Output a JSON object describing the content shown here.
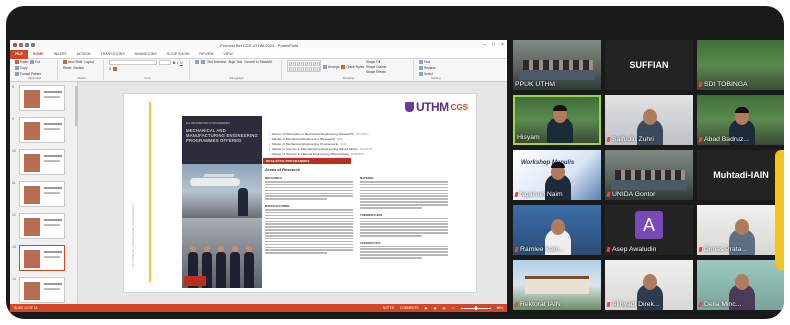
{
  "ppt": {
    "window_title": "Promosi Bei CGS UTHM 2021 - PowerPoint",
    "tabs": [
      "FILE",
      "HOME",
      "INSERT",
      "DESIGN",
      "TRANSITIONS",
      "ANIMATIONS",
      "SLIDE SHOW",
      "REVIEW",
      "VIEW"
    ],
    "ribbon": {
      "clipboard": {
        "items": [
          "Cut",
          "Copy",
          "Format Painter"
        ],
        "label": "Clipboard",
        "paste": "Paste"
      },
      "slides": {
        "items": [
          "Layout",
          "Reset",
          "Section"
        ],
        "label": "Slides",
        "new": "New Slide"
      },
      "font": {
        "label": "Font"
      },
      "paragraph": {
        "label": "Paragraph",
        "items": [
          "Text Direction",
          "Align Text",
          "Convert to SmartArt"
        ]
      },
      "drawing": {
        "label": "Drawing",
        "items": [
          "Shape Fill",
          "Shape Outline",
          "Shape Effects"
        ],
        "arrange": "Arrange",
        "quick": "Quick Styles"
      },
      "editing": {
        "label": "Editing",
        "items": [
          "Find",
          "Replace",
          "Select"
        ]
      }
    },
    "thumbnails": [
      "8",
      "9",
      "10",
      "11",
      "12",
      "13",
      "14"
    ],
    "selected_thumb": "13",
    "slide": {
      "logo_text": "UTHM",
      "logo_suffix": "CGS",
      "side_text": "MECHANICAL ENGINEERING PROGRAMMES",
      "brochure_small": "ALL INFORMATION & PROGRAMMES",
      "brochure_title": "MECHANICAL AND MANUFACTURING ENGINEERING PROGRAMMES OFFERED",
      "degrees": [
        {
          "name": "Doctor of Philosophy in Mechanical Engineering (Research)",
          "mode": "MJ41/MV41"
        },
        {
          "name": "Master of Mechanical Engineering (Research)",
          "mode": "MJ42"
        },
        {
          "name": "Master of Mechanical Engineering (Coursework)",
          "mode": "MJ43"
        },
        {
          "name": "Master of Science in Manufacturing Engineering (Mixed Mode)",
          "mode": "MJ44/MV44"
        },
        {
          "name": "Master of Science in Material Engineering (Mixed Mode)",
          "mode": "MJ45/MV45"
        }
      ],
      "research_bar": "RESEARCH PROGRAMMES",
      "areas_heading": "Areas of Research",
      "col1": [
        "MECHANICS",
        "MANUFACTURING"
      ],
      "col2": [
        "MATERIAL",
        "THERMOFLUIDS",
        "AERONAUTICS"
      ]
    },
    "status": {
      "left": "SLIDE 13 OF 18",
      "notes": "NOTES",
      "comments": "COMMENTS",
      "zoom": "86%"
    }
  },
  "participants": [
    {
      "name": "PPUK UTHM",
      "muted": false
    },
    {
      "name": "SUFFIAN",
      "muted": false
    },
    {
      "name": "SDI TOBINGA",
      "muted": true
    },
    {
      "name": "Hisyam",
      "muted": false
    },
    {
      "name": "Saifudin Zuhri",
      "muted": true
    },
    {
      "name": "Abad Badruz...",
      "muted": true
    },
    {
      "name": "Ngaisun Naim",
      "muted": true
    },
    {
      "name": "UNIDA Gontor",
      "muted": true
    },
    {
      "name": "Muhtadi-IAIN",
      "muted": false
    },
    {
      "name": "Ramlee Kam...",
      "muted": true
    },
    {
      "name": "Asep Awaludin",
      "muted": true
    },
    {
      "name": "Dimas Prata...",
      "muted": true
    },
    {
      "name": "Rektorat IAIN",
      "muted": true
    },
    {
      "name": "Akhyadi Direk...",
      "muted": true
    },
    {
      "name": "Delia Minc...",
      "muted": true
    }
  ],
  "avatar_letter": "A",
  "poster_text": "Workshop Menulis",
  "colors": {
    "ppt_accent": "#d24726",
    "active_speaker": "#9fd44a",
    "uthm_purple": "#5b2d86",
    "mic_muted": "#e8453c"
  }
}
